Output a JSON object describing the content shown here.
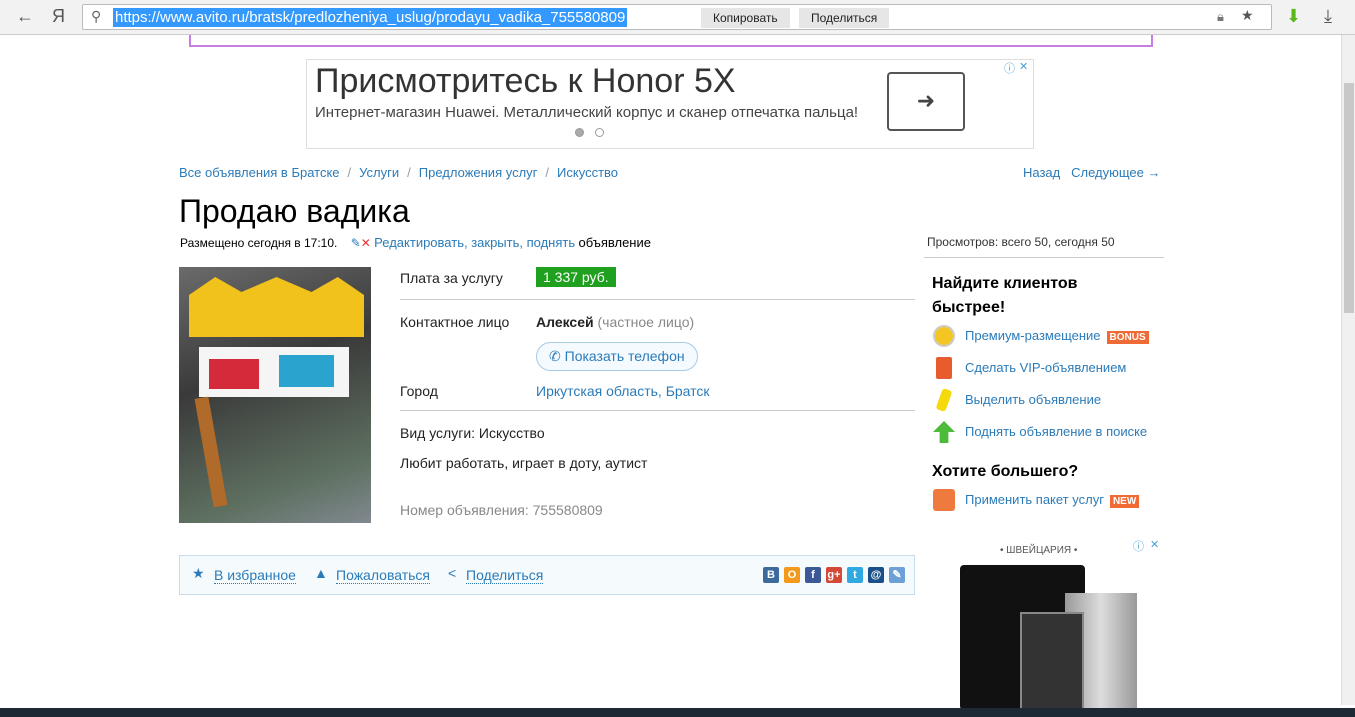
{
  "browser": {
    "url": "https://www.avito.ru/bratsk/predlozheniya_uslug/prodayu_vadika_755580809",
    "copy": "Копировать",
    "share": "Поделиться",
    "yandex": "Я"
  },
  "ad": {
    "title": "Присмотритесь к Honor 5X",
    "text": "Интернет-магазин Huawei. Металлический корпус и сканер отпечатка пальца!"
  },
  "breadcrumbs": [
    "Все объявления в Братске",
    "Услуги",
    "Предложения услуг",
    "Искусство"
  ],
  "nav": {
    "back": "Назад",
    "next": "Следующее →"
  },
  "listing": {
    "title": "Продаю вадика",
    "posted": "Размещено сегодня в 17:10.",
    "edit_links": "Редактировать, закрыть, поднять",
    "edit_suffix": "объявление",
    "price_label": "Плата за услугу",
    "price": "1 337 руб.",
    "contact_label": "Контактное лицо",
    "contact_name": "Алексей",
    "contact_type": "(частное лицо)",
    "show_phone": "Показать телефон",
    "city_label": "Город",
    "city": "Иркутская область, Братск",
    "service_type": "Вид услуги: Искусство",
    "description": "Любит работать, играет в доту, аутист",
    "number": "Номер объявления: 755580809"
  },
  "actions": {
    "favorite": "В избранное",
    "report": "Пожаловаться",
    "share": "Поделиться",
    "social": [
      {
        "label": "В",
        "color": "#3d6a9d"
      },
      {
        "label": "О",
        "color": "#f49a1a"
      },
      {
        "label": "f",
        "color": "#3b5998"
      },
      {
        "label": "g+",
        "color": "#d34836"
      },
      {
        "label": "t",
        "color": "#2fa9e0"
      },
      {
        "label": "@",
        "color": "#1a4f8a"
      },
      {
        "label": "✎",
        "color": "#6ea0d8"
      }
    ]
  },
  "sidebar": {
    "views": "Просмотров: всего 50, сегодня 50",
    "heading1": "Найдите клиентов быстрее!",
    "items": [
      {
        "label": "Премиум-размещение",
        "badge": "BONUS"
      },
      {
        "label": "Сделать VIP-объявлением"
      },
      {
        "label": "Выделить объявление"
      },
      {
        "label": "Поднять объявление в поиске"
      }
    ],
    "heading2": "Хотите большего?",
    "package": {
      "label": "Применить пакет услуг",
      "badge": "NEW"
    },
    "ad_label": "• ШВЕЙЦАРИЯ •"
  }
}
